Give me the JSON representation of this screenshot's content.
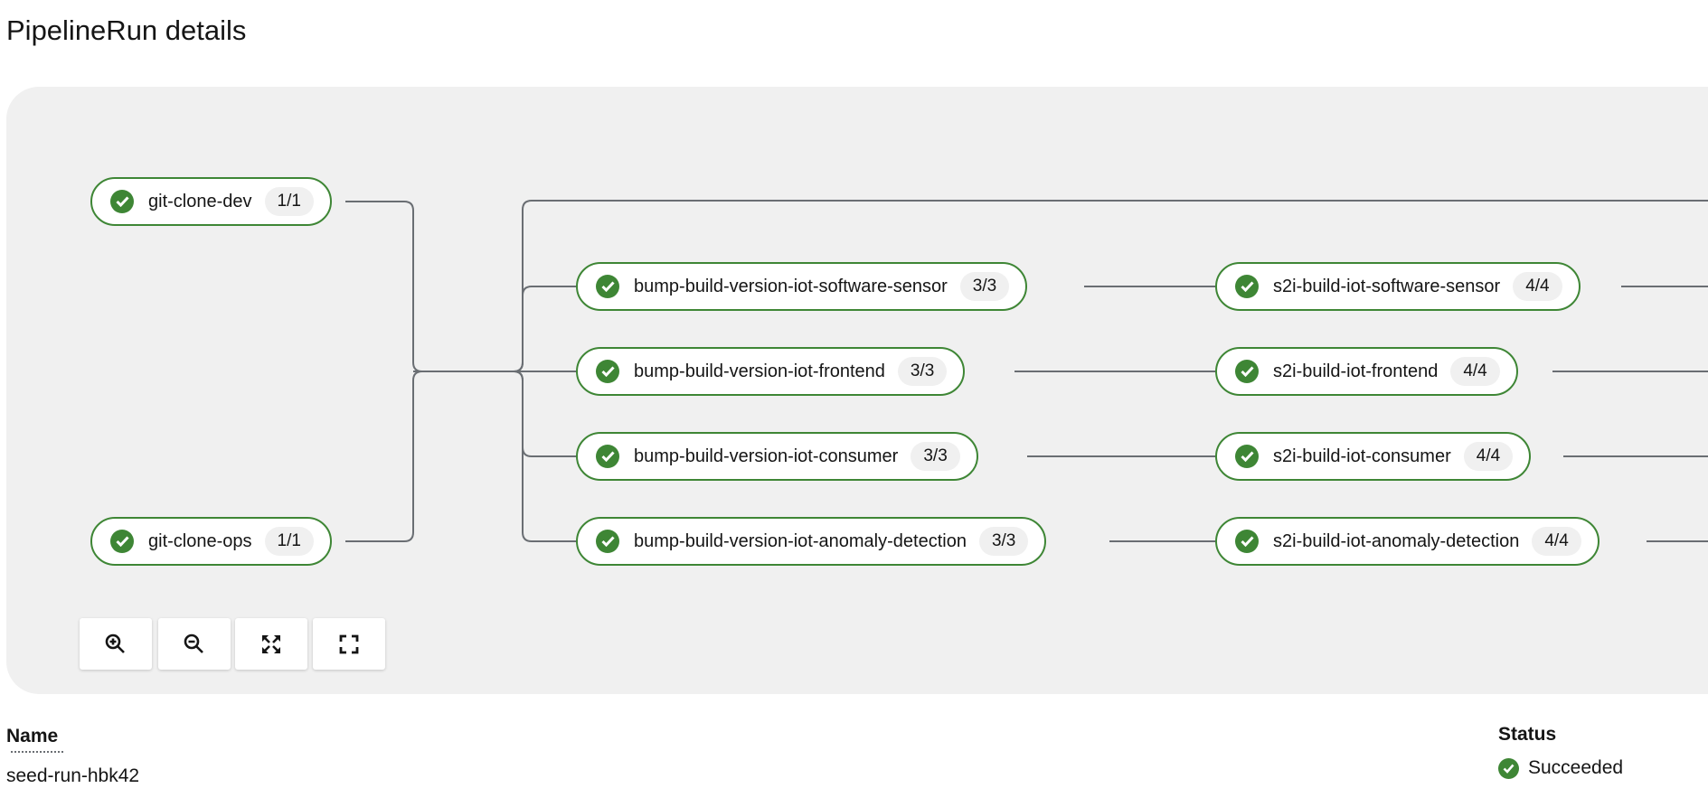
{
  "page": {
    "title": "PipelineRun details"
  },
  "colors": {
    "success": "#3e8635",
    "edge": "#6a6e73",
    "panel": "#f0f0f0"
  },
  "graph": {
    "nodes": [
      {
        "id": "git-clone-dev",
        "label": "git-clone-dev",
        "count": "1/1",
        "status": "succeeded"
      },
      {
        "id": "git-clone-ops",
        "label": "git-clone-ops",
        "count": "1/1",
        "status": "succeeded"
      },
      {
        "id": "bump-sensor",
        "label": "bump-build-version-iot-software-sensor",
        "count": "3/3",
        "status": "succeeded"
      },
      {
        "id": "bump-frontend",
        "label": "bump-build-version-iot-frontend",
        "count": "3/3",
        "status": "succeeded"
      },
      {
        "id": "bump-consumer",
        "label": "bump-build-version-iot-consumer",
        "count": "3/3",
        "status": "succeeded"
      },
      {
        "id": "bump-anomaly",
        "label": "bump-build-version-iot-anomaly-detection",
        "count": "3/3",
        "status": "succeeded"
      },
      {
        "id": "s2i-sensor",
        "label": "s2i-build-iot-software-sensor",
        "count": "4/4",
        "status": "succeeded"
      },
      {
        "id": "s2i-frontend",
        "label": "s2i-build-iot-frontend",
        "count": "4/4",
        "status": "succeeded"
      },
      {
        "id": "s2i-consumer",
        "label": "s2i-build-iot-consumer",
        "count": "4/4",
        "status": "succeeded"
      },
      {
        "id": "s2i-anomaly",
        "label": "s2i-build-iot-anomaly-detection",
        "count": "4/4",
        "status": "succeeded"
      }
    ],
    "toolbar": [
      {
        "name": "zoom-in-button",
        "icon": "zoom-in-icon"
      },
      {
        "name": "zoom-out-button",
        "icon": "zoom-out-icon"
      },
      {
        "name": "fit-to-screen-button",
        "icon": "expand-arrows-icon"
      },
      {
        "name": "reset-view-button",
        "icon": "fullscreen-icon"
      }
    ]
  },
  "details": {
    "name_label": "Name",
    "name_value": "seed-run-hbk42",
    "status_label": "Status",
    "status_value": "Succeeded",
    "status_icon": "check-circle-icon"
  }
}
